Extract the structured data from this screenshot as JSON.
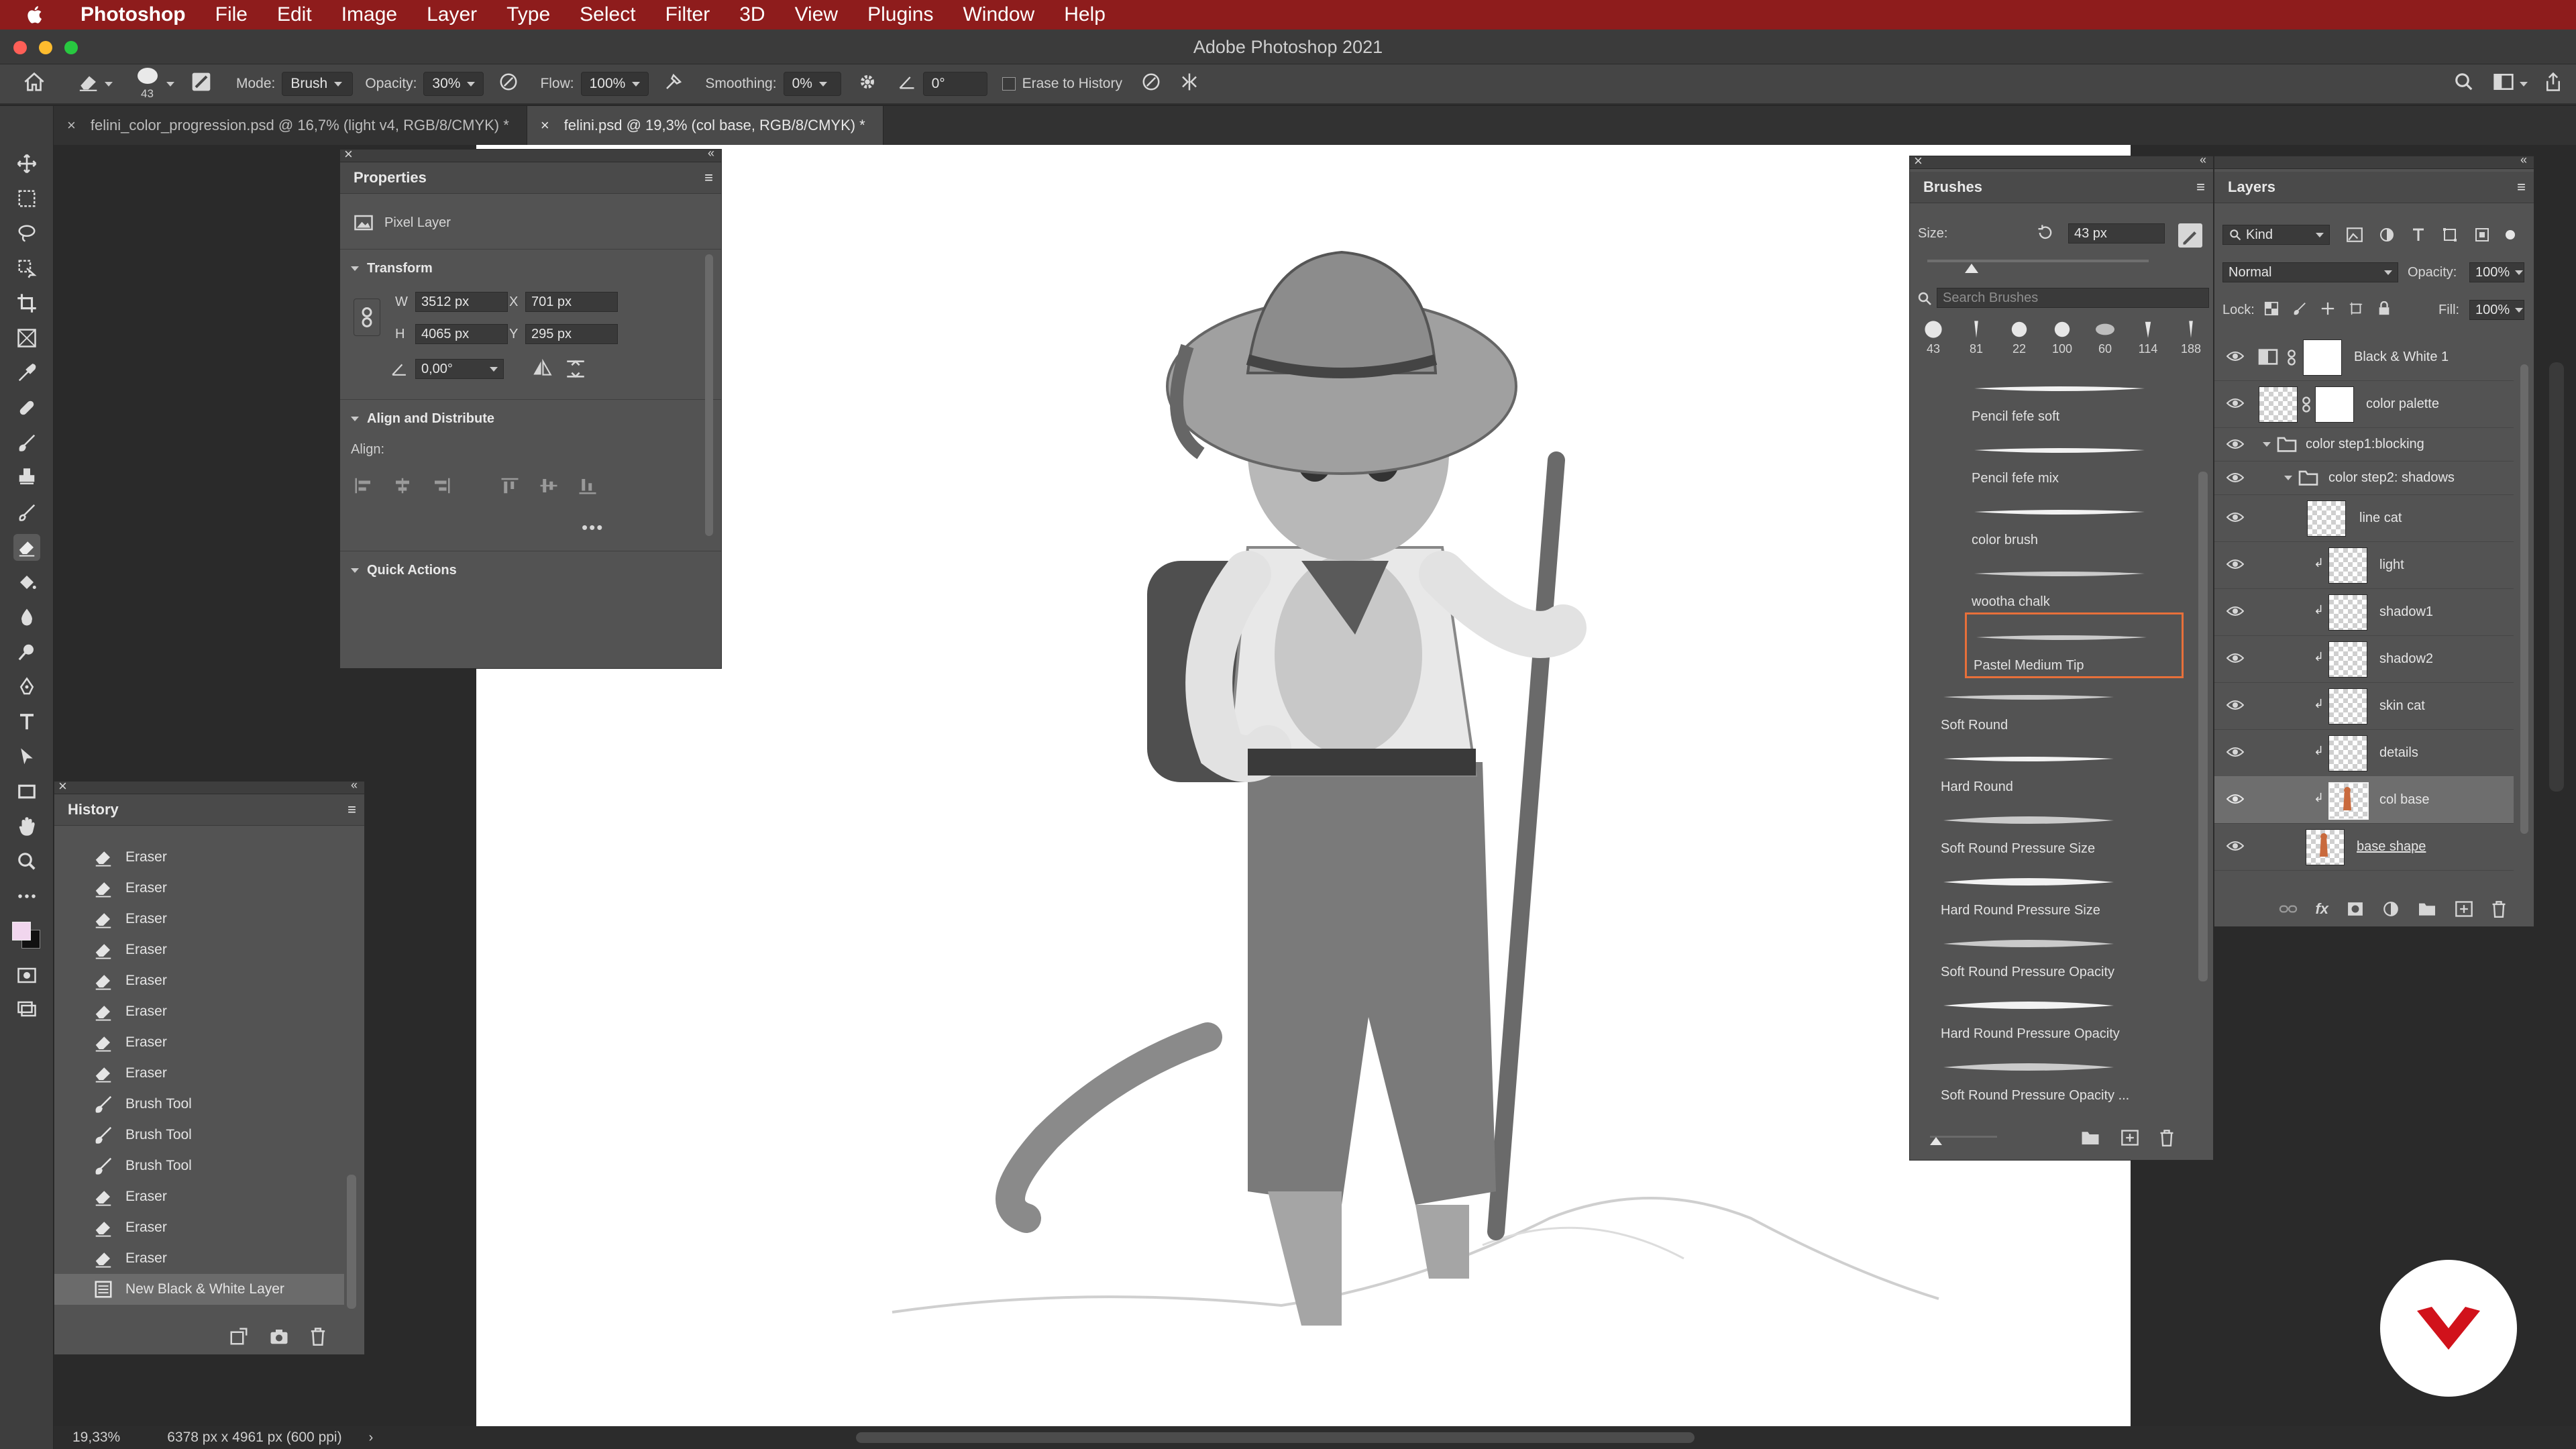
{
  "menubar": {
    "app": "Photoshop",
    "items": [
      "File",
      "Edit",
      "Image",
      "Layer",
      "Type",
      "Select",
      "Filter",
      "3D",
      "View",
      "Plugins",
      "Window",
      "Help"
    ]
  },
  "window": {
    "title": "Adobe Photoshop 2021"
  },
  "options": {
    "brush_size": "43",
    "mode_label": "Mode:",
    "mode_value": "Brush",
    "opacity_label": "Opacity:",
    "opacity_value": "30%",
    "flow_label": "Flow:",
    "flow_value": "100%",
    "smoothing_label": "Smoothing:",
    "smoothing_value": "0%",
    "angle_value": "0°",
    "erase_history_label": "Erase to History"
  },
  "tabs": [
    {
      "label": "felini_color_progression.psd @ 16,7% (light v4, RGB/8/CMYK) *"
    },
    {
      "label": "felini.psd @ 19,3% (col base, RGB/8/CMYK) *"
    }
  ],
  "properties": {
    "title": "Properties",
    "layer_type": "Pixel Layer",
    "transform_label": "Transform",
    "w_label": "W",
    "w_value": "3512 px",
    "h_label": "H",
    "h_value": "4065 px",
    "x_label": "X",
    "x_value": "701 px",
    "y_label": "Y",
    "y_value": "295 px",
    "angle_value": "0,00°",
    "align_section": "Align and Distribute",
    "align_label": "Align:",
    "quick_actions": "Quick Actions"
  },
  "history": {
    "title": "History",
    "items": [
      {
        "icon": "eraser-icon",
        "label": "Eraser"
      },
      {
        "icon": "eraser-icon",
        "label": "Eraser"
      },
      {
        "icon": "eraser-icon",
        "label": "Eraser"
      },
      {
        "icon": "eraser-icon",
        "label": "Eraser"
      },
      {
        "icon": "eraser-icon",
        "label": "Eraser"
      },
      {
        "icon": "eraser-icon",
        "label": "Eraser"
      },
      {
        "icon": "eraser-icon",
        "label": "Eraser"
      },
      {
        "icon": "eraser-icon",
        "label": "Eraser"
      },
      {
        "icon": "brush-icon",
        "label": "Brush Tool"
      },
      {
        "icon": "brush-icon",
        "label": "Brush Tool"
      },
      {
        "icon": "brush-icon",
        "label": "Brush Tool"
      },
      {
        "icon": "eraser-icon",
        "label": "Eraser"
      },
      {
        "icon": "eraser-icon",
        "label": "Eraser"
      },
      {
        "icon": "eraser-icon",
        "label": "Eraser"
      },
      {
        "icon": "layer-icon",
        "label": "New Black & White Layer"
      }
    ]
  },
  "brushes": {
    "title": "Brushes",
    "size_label": "Size:",
    "size_value": "43 px",
    "search_placeholder": "Search Brushes",
    "presets": [
      "43",
      "81",
      "22",
      "100",
      "60",
      "114",
      "188"
    ],
    "items": [
      {
        "label": "Pencil fefe soft"
      },
      {
        "label": "Pencil fefe mix"
      },
      {
        "label": "color brush"
      },
      {
        "label": "wootha chalk"
      },
      {
        "label": "Pastel Medium Tip"
      },
      {
        "label": "Soft Round"
      },
      {
        "label": "Hard Round"
      },
      {
        "label": "Soft Round Pressure Size"
      },
      {
        "label": "Hard Round Pressure Size"
      },
      {
        "label": "Soft Round Pressure Opacity"
      },
      {
        "label": "Hard Round Pressure Opacity"
      },
      {
        "label": "Soft Round Pressure Opacity ..."
      }
    ]
  },
  "layers": {
    "title": "Layers",
    "filter_kind": "Kind",
    "blend_mode": "Normal",
    "opacity_label": "Opacity:",
    "opacity_value": "100%",
    "lock_label": "Lock:",
    "fill_label": "Fill:",
    "fill_value": "100%",
    "items": [
      {
        "label": "Black & White 1"
      },
      {
        "label": "color palette"
      },
      {
        "label": "color step1:blocking"
      },
      {
        "label": "color step2: shadows"
      },
      {
        "label": "line cat"
      },
      {
        "label": "light"
      },
      {
        "label": "shadow1"
      },
      {
        "label": "shadow2"
      },
      {
        "label": "skin cat"
      },
      {
        "label": "details"
      },
      {
        "label": "col base"
      },
      {
        "label": "base shape"
      }
    ]
  },
  "status": {
    "zoom": "19,33%",
    "doc_size": "6378 px x 4961 px (600 ppi)"
  },
  "colors": {
    "menubar": "#8e1c1c",
    "accent_orange": "#e8703a",
    "logo_red": "#d1121b"
  }
}
